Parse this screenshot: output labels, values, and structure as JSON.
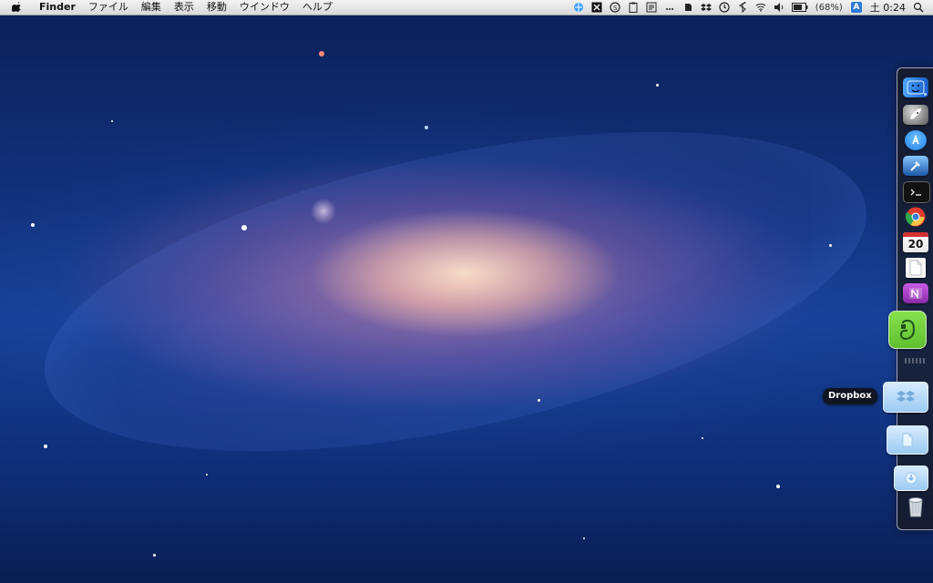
{
  "menubar": {
    "app_name": "Finder",
    "items": [
      "ファイル",
      "編集",
      "表示",
      "移動",
      "ウインドウ",
      "ヘルプ"
    ],
    "battery_percent": "(68%)",
    "input_method": "A",
    "clock": "土 0:24"
  },
  "dock": {
    "tooltip": "Dropbox",
    "apps": [
      {
        "name": "Finder",
        "icon": "finder-icon"
      },
      {
        "name": "Launchpad",
        "icon": "launchpad-rocket-icon"
      },
      {
        "name": "App Store",
        "icon": "app-store-icon"
      },
      {
        "name": "Xcode",
        "icon": "xcode-hammer-icon"
      },
      {
        "name": "Terminal",
        "icon": "terminal-icon"
      },
      {
        "name": "Chrome",
        "icon": "chrome-icon"
      },
      {
        "name": "Calendar",
        "icon": "calendar-icon",
        "day": "20"
      },
      {
        "name": "TextEdit",
        "icon": "document-icon"
      },
      {
        "name": "OneNote",
        "icon": "onenote-icon"
      },
      {
        "name": "Evernote",
        "icon": "evernote-icon"
      }
    ],
    "stacks": [
      {
        "name": "Dropbox",
        "icon": "dropbox-folder-icon"
      },
      {
        "name": "Documents",
        "icon": "documents-folder-icon"
      },
      {
        "name": "Downloads",
        "icon": "downloads-folder-icon"
      },
      {
        "name": "Trash",
        "icon": "trash-icon"
      }
    ]
  },
  "colors": {
    "menubar_top": "#f3f3f3",
    "menubar_bottom": "#d9d9d9",
    "dock_bg": "#19191e",
    "evernote_green": "#5fbf2f",
    "onenote_purple": "#8a2aa6",
    "appstore_blue": "#1e7be6"
  }
}
